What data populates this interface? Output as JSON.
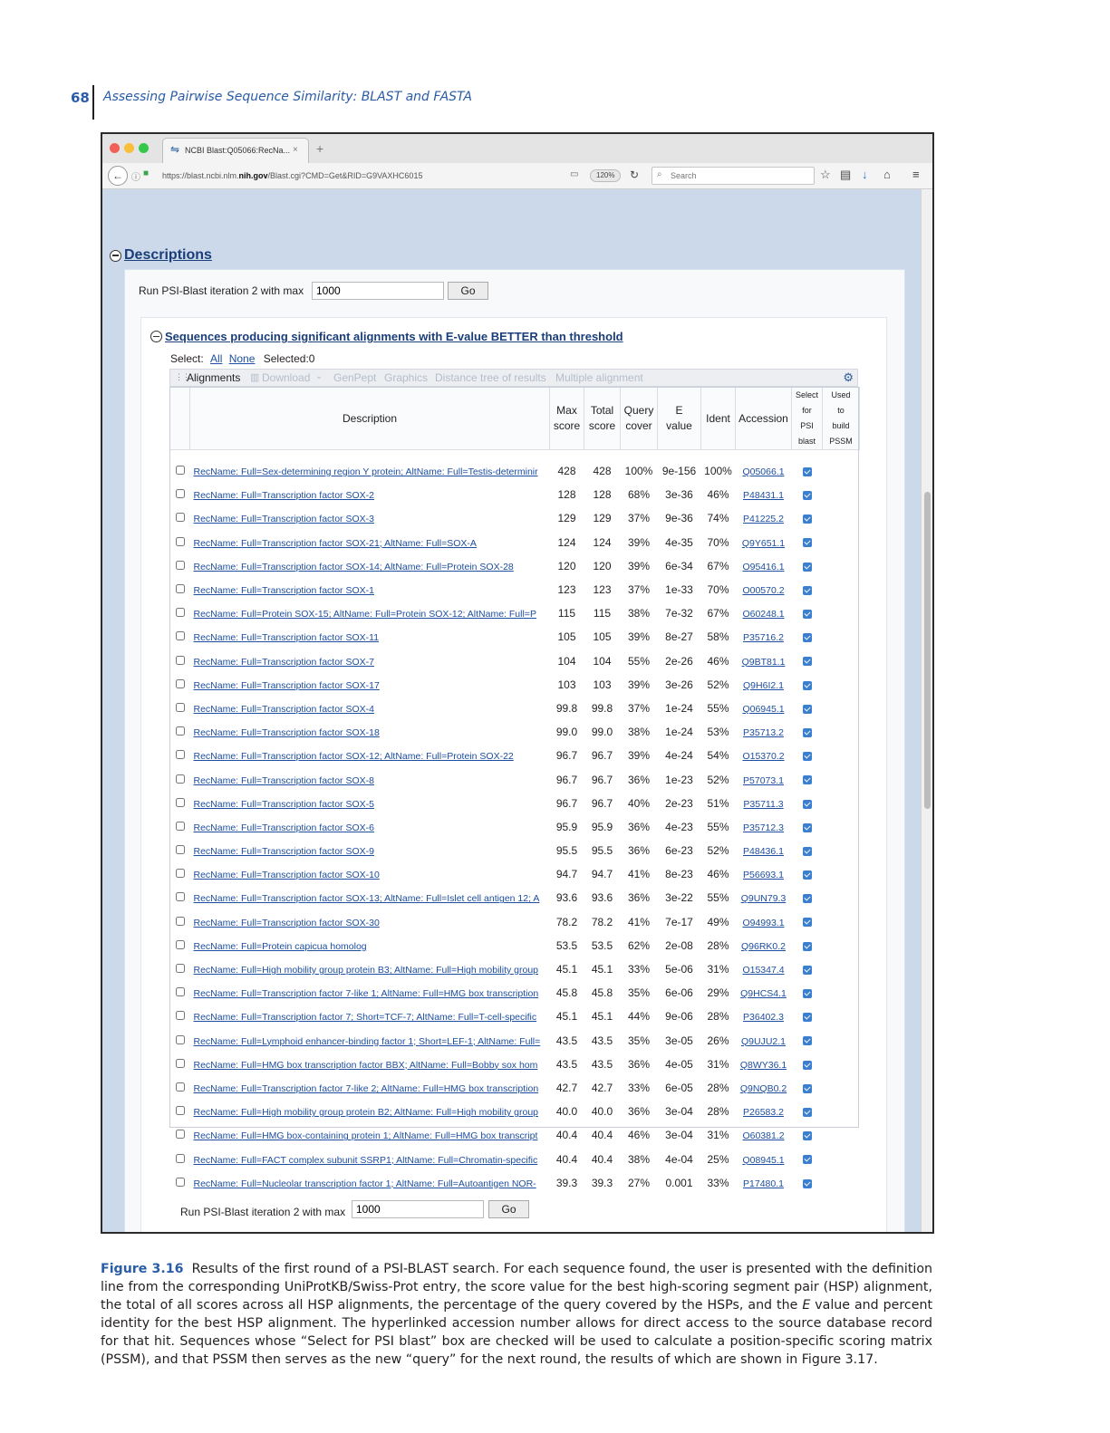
{
  "page": {
    "number": "68",
    "running_head": "Assessing Pairwise Sequence Similarity: BLAST and FASTA"
  },
  "browser": {
    "tab_title": "NCBI Blast:Q05066:RecNa...",
    "tab_close": "×",
    "new_tab": "+",
    "url_prefix": "https://blast.ncbi.nlm.",
    "url_bold": "nih.gov",
    "url_suffix": "/Blast.cgi?CMD=Get&RID=G9VAXHC6015",
    "zoom": "120%",
    "search_placeholder": "Search",
    "traffic_lights": [
      "#f25f58",
      "#f9be3a",
      "#35c84b"
    ],
    "icons": [
      "star-icon",
      "reading-list-icon",
      "download-arrow-icon",
      "home-icon",
      "menu-icon"
    ]
  },
  "descriptions": {
    "title": "Descriptions",
    "psi_label": "Run PSI-Blast iteration 2 with max",
    "psi_value": "1000",
    "go_label": "Go"
  },
  "sequences": {
    "title": "Sequences producing significant alignments with E-value BETTER than threshold",
    "select_label": "Select:",
    "select_all": "All",
    "select_none": "None",
    "selected_label": "Selected:0",
    "toolbar": {
      "alignments": "Alignments",
      "download": "Download",
      "download_caret": "⌄",
      "genpept": "GenPept",
      "graphics": "Graphics",
      "distance_tree": "Distance tree of results",
      "multiple_alignment": "Multiple alignment"
    },
    "columns": {
      "description": "Description",
      "max_score_1": "Max",
      "max_score_2": "score",
      "total_score_1": "Total",
      "total_score_2": "score",
      "query_cover_1": "Query",
      "query_cover_2": "cover",
      "e_value_1": "E",
      "e_value_2": "value",
      "ident": "Ident",
      "accession": "Accession",
      "select_1": "Select",
      "select_2": "for",
      "select_3": "PSI",
      "select_4": "blast",
      "used_1": "Used",
      "used_2": "to",
      "used_3": "build",
      "used_4": "PSSM"
    },
    "rows": [
      {
        "description": "RecName: Full=Sex-determining region Y protein; AltName: Full=Testis-determinir",
        "max": "428",
        "total": "428",
        "cover": "100%",
        "evalue": "9e-156",
        "ident": "100%",
        "accession": "Q05066.1"
      },
      {
        "description": "RecName: Full=Transcription factor SOX-2",
        "max": "128",
        "total": "128",
        "cover": "68%",
        "evalue": "3e-36",
        "ident": "46%",
        "accession": "P48431.1"
      },
      {
        "description": "RecName: Full=Transcription factor SOX-3",
        "max": "129",
        "total": "129",
        "cover": "37%",
        "evalue": "9e-36",
        "ident": "74%",
        "accession": "P41225.2"
      },
      {
        "description": "RecName: Full=Transcription factor SOX-21; AltName: Full=SOX-A",
        "max": "124",
        "total": "124",
        "cover": "39%",
        "evalue": "4e-35",
        "ident": "70%",
        "accession": "Q9Y651.1"
      },
      {
        "description": "RecName: Full=Transcription factor SOX-14; AltName: Full=Protein SOX-28",
        "max": "120",
        "total": "120",
        "cover": "39%",
        "evalue": "6e-34",
        "ident": "67%",
        "accession": "O95416.1"
      },
      {
        "description": "RecName: Full=Transcription factor SOX-1",
        "max": "123",
        "total": "123",
        "cover": "37%",
        "evalue": "1e-33",
        "ident": "70%",
        "accession": "O00570.2"
      },
      {
        "description": "RecName: Full=Protein SOX-15; AltName: Full=Protein SOX-12; AltName: Full=P",
        "max": "115",
        "total": "115",
        "cover": "38%",
        "evalue": "7e-32",
        "ident": "67%",
        "accession": "O60248.1"
      },
      {
        "description": "RecName: Full=Transcription factor SOX-11",
        "max": "105",
        "total": "105",
        "cover": "39%",
        "evalue": "8e-27",
        "ident": "58%",
        "accession": "P35716.2"
      },
      {
        "description": "RecName: Full=Transcription factor SOX-7",
        "max": "104",
        "total": "104",
        "cover": "55%",
        "evalue": "2e-26",
        "ident": "46%",
        "accession": "Q9BT81.1"
      },
      {
        "description": "RecName: Full=Transcription factor SOX-17",
        "max": "103",
        "total": "103",
        "cover": "39%",
        "evalue": "3e-26",
        "ident": "52%",
        "accession": "Q9H6I2.1"
      },
      {
        "description": "RecName: Full=Transcription factor SOX-4",
        "max": "99.8",
        "total": "99.8",
        "cover": "37%",
        "evalue": "1e-24",
        "ident": "55%",
        "accession": "Q06945.1"
      },
      {
        "description": "RecName: Full=Transcription factor SOX-18",
        "max": "99.0",
        "total": "99.0",
        "cover": "38%",
        "evalue": "1e-24",
        "ident": "53%",
        "accession": "P35713.2"
      },
      {
        "description": "RecName: Full=Transcription factor SOX-12; AltName: Full=Protein SOX-22",
        "max": "96.7",
        "total": "96.7",
        "cover": "39%",
        "evalue": "4e-24",
        "ident": "54%",
        "accession": "O15370.2"
      },
      {
        "description": "RecName: Full=Transcription factor SOX-8",
        "max": "96.7",
        "total": "96.7",
        "cover": "36%",
        "evalue": "1e-23",
        "ident": "52%",
        "accession": "P57073.1"
      },
      {
        "description": "RecName: Full=Transcription factor SOX-5",
        "max": "96.7",
        "total": "96.7",
        "cover": "40%",
        "evalue": "2e-23",
        "ident": "51%",
        "accession": "P35711.3"
      },
      {
        "description": "RecName: Full=Transcription factor SOX-6",
        "max": "95.9",
        "total": "95.9",
        "cover": "36%",
        "evalue": "4e-23",
        "ident": "55%",
        "accession": "P35712.3"
      },
      {
        "description": "RecName: Full=Transcription factor SOX-9",
        "max": "95.5",
        "total": "95.5",
        "cover": "36%",
        "evalue": "6e-23",
        "ident": "52%",
        "accession": "P48436.1"
      },
      {
        "description": "RecName: Full=Transcription factor SOX-10",
        "max": "94.7",
        "total": "94.7",
        "cover": "41%",
        "evalue": "8e-23",
        "ident": "46%",
        "accession": "P56693.1"
      },
      {
        "description": "RecName: Full=Transcription factor SOX-13; AltName: Full=Islet cell antigen 12; A",
        "max": "93.6",
        "total": "93.6",
        "cover": "36%",
        "evalue": "3e-22",
        "ident": "55%",
        "accession": "Q9UN79.3"
      },
      {
        "description": "RecName: Full=Transcription factor SOX-30",
        "max": "78.2",
        "total": "78.2",
        "cover": "41%",
        "evalue": "7e-17",
        "ident": "49%",
        "accession": "O94993.1"
      },
      {
        "description": "RecName: Full=Protein capicua homolog",
        "max": "53.5",
        "total": "53.5",
        "cover": "62%",
        "evalue": "2e-08",
        "ident": "28%",
        "accession": "Q96RK0.2"
      },
      {
        "description": "RecName: Full=High mobility group protein B3; AltName: Full=High mobility group",
        "max": "45.1",
        "total": "45.1",
        "cover": "33%",
        "evalue": "5e-06",
        "ident": "31%",
        "accession": "O15347.4"
      },
      {
        "description": "RecName: Full=Transcription factor 7-like 1; AltName: Full=HMG box transcription",
        "max": "45.8",
        "total": "45.8",
        "cover": "35%",
        "evalue": "6e-06",
        "ident": "29%",
        "accession": "Q9HCS4.1"
      },
      {
        "description": "RecName: Full=Transcription factor 7; Short=TCF-7; AltName: Full=T-cell-specific",
        "max": "45.1",
        "total": "45.1",
        "cover": "44%",
        "evalue": "9e-06",
        "ident": "28%",
        "accession": "P36402.3"
      },
      {
        "description": "RecName: Full=Lymphoid enhancer-binding factor 1; Short=LEF-1; AltName: Full=",
        "max": "43.5",
        "total": "43.5",
        "cover": "35%",
        "evalue": "3e-05",
        "ident": "26%",
        "accession": "Q9UJU2.1"
      },
      {
        "description": "RecName: Full=HMG box transcription factor BBX; AltName: Full=Bobby sox hom",
        "max": "43.5",
        "total": "43.5",
        "cover": "36%",
        "evalue": "4e-05",
        "ident": "31%",
        "accession": "Q8WY36.1"
      },
      {
        "description": "RecName: Full=Transcription factor 7-like 2; AltName: Full=HMG box transcription",
        "max": "42.7",
        "total": "42.7",
        "cover": "33%",
        "evalue": "6e-05",
        "ident": "28%",
        "accession": "Q9NQB0.2"
      },
      {
        "description": "RecName: Full=High mobility group protein B2; AltName: Full=High mobility group",
        "max": "40.0",
        "total": "40.0",
        "cover": "36%",
        "evalue": "3e-04",
        "ident": "28%",
        "accession": "P26583.2"
      },
      {
        "description": "RecName: Full=HMG box-containing protein 1; AltName: Full=HMG box transcript",
        "max": "40.4",
        "total": "40.4",
        "cover": "46%",
        "evalue": "3e-04",
        "ident": "31%",
        "accession": "O60381.2"
      },
      {
        "description": "RecName: Full=FACT complex subunit SSRP1; AltName: Full=Chromatin-specific",
        "max": "40.4",
        "total": "40.4",
        "cover": "38%",
        "evalue": "4e-04",
        "ident": "25%",
        "accession": "Q08945.1"
      },
      {
        "description": "RecName: Full=Nucleolar transcription factor 1; AltName: Full=Autoantigen NOR-",
        "max": "39.3",
        "total": "39.3",
        "cover": "27%",
        "evalue": "0.001",
        "ident": "33%",
        "accession": "P17480.1"
      }
    ],
    "psi_label": "Run PSI-Blast iteration 2 with max",
    "psi_value": "1000",
    "go_label": "Go"
  },
  "caption": {
    "label": "Figure 3.16",
    "text_1": "Results of the first round of a PSI-BLAST search. For each sequence found, the user is presented with the definition line from the corresponding UniProtKB/Swiss-Prot entry, the score value for the best high-scoring segment pair (HSP) alignment, the total of all scores across all HSP alignments, the percentage of the query covered by the HSPs, and the ",
    "italic": "E",
    "text_2": " value and percent identity for the best HSP alignment. The hyperlinked accession number allows for direct access to the source database record for that hit. Sequences whose “Select for PSI blast” box are checked will be used to calculate a position-specific scoring matrix (PSSM), and that PSSM then serves as the new “query” for the next round, the results of which are shown in Figure 3.17."
  }
}
